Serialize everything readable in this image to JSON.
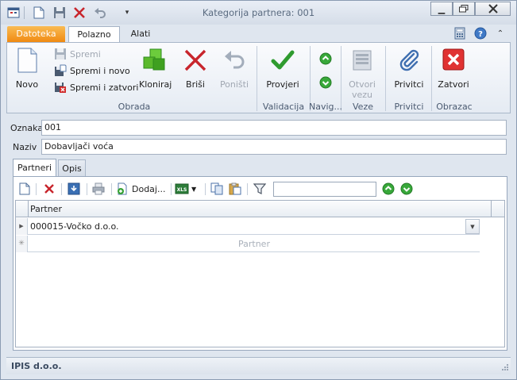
{
  "window": {
    "title": "Kategorija partnera: 001"
  },
  "ribbon_tabs": [
    "Datoteka",
    "Polazno",
    "Alati"
  ],
  "ribbon": {
    "novo": "Novo",
    "spremi": "Spremi",
    "spremi_i_novo": "Spremi i novo",
    "spremi_i_zatvori": "Spremi i zatvori",
    "kloniraj": "Kloniraj",
    "brisi": "Briši",
    "ponisti": "Poništi",
    "provjeri": "Provjeri",
    "otvori_vezu_1": "Otvori",
    "otvori_vezu_2": "vezu",
    "privitci": "Privitci",
    "zatvori": "Zatvori",
    "groups": {
      "obrada": "Obrada",
      "validacija": "Validacija",
      "navig": "Navig...",
      "veze": "Veze",
      "privitci": "Privitci",
      "obrazac": "Obrazac"
    }
  },
  "form": {
    "oznaka_label": "Oznaka",
    "oznaka_value": "001",
    "naziv_label": "Naziv",
    "naziv_value": "Dobavljači voća"
  },
  "detail_tabs": [
    "Partneri",
    "Opis"
  ],
  "toolbar": {
    "dodaj": "Dodaj...",
    "filter_value": ""
  },
  "grid": {
    "column": "Partner",
    "rows": [
      "000015-Vočko d.o.o."
    ],
    "new_row_placeholder": "Partner"
  },
  "status": {
    "company": "IPIS d.o.o."
  },
  "colors": {
    "accent": "#f08a12",
    "frame": "#dfe6ef",
    "delete": "#c8252c",
    "green": "#2a9a2a"
  }
}
